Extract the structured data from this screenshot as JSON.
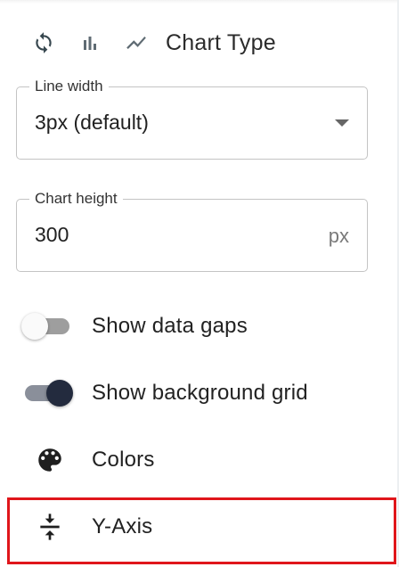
{
  "toolbar": {
    "icons": [
      "refresh-icon",
      "bar-chart-icon",
      "line-chart-icon"
    ],
    "title": "Chart Type"
  },
  "line_width": {
    "label": "Line width",
    "value": "3px (default)"
  },
  "chart_height": {
    "label": "Chart height",
    "value": "300",
    "unit": "px"
  },
  "toggles": [
    {
      "label": "Show data gaps",
      "on": false
    },
    {
      "label": "Show background grid",
      "on": true
    }
  ],
  "menu": {
    "colors_label": "Colors",
    "y_axis_label": "Y-Axis"
  },
  "colors": {
    "highlight": "#e0161b",
    "switch_on_thumb": "#232b3e",
    "switch_on_track": "#8a8f9a",
    "switch_off_track": "#9e9e9e",
    "icon": "#37474f"
  }
}
